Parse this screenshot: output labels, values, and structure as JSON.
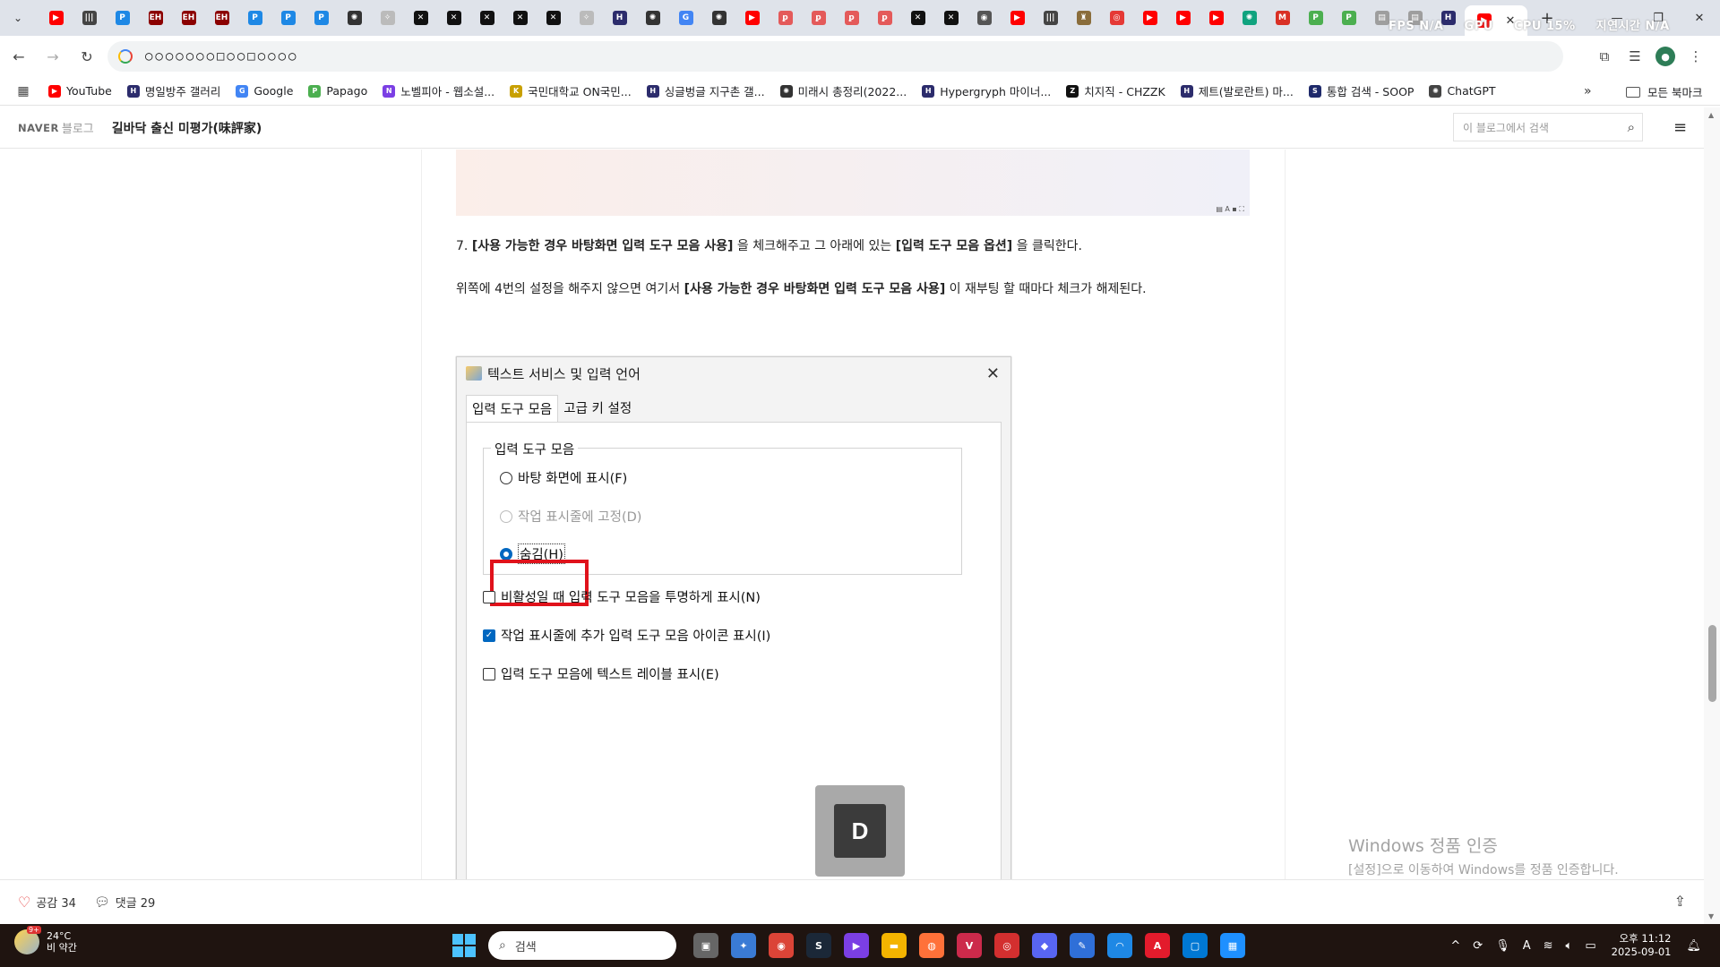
{
  "browser": {
    "tabs": [
      {
        "icon": "youtube-icon",
        "color": "#ff0000",
        "glyph": "▶"
      },
      {
        "icon": "bars-icon",
        "color": "#444444",
        "glyph": "|||"
      },
      {
        "icon": "p-icon",
        "color": "#1e88e5",
        "glyph": "P"
      },
      {
        "icon": "eh-icon",
        "color": "#8b0000",
        "glyph": "EH"
      },
      {
        "icon": "eh-icon",
        "color": "#8b0000",
        "glyph": "EH"
      },
      {
        "icon": "eh-icon",
        "color": "#8b0000",
        "glyph": "EH"
      },
      {
        "icon": "p-icon",
        "color": "#1e88e5",
        "glyph": "P"
      },
      {
        "icon": "p-icon",
        "color": "#1e88e5",
        "glyph": "P"
      },
      {
        "icon": "p-icon",
        "color": "#1e88e5",
        "glyph": "P"
      },
      {
        "icon": "openai-icon",
        "color": "#333333",
        "glyph": "✺"
      },
      {
        "icon": "feather-icon",
        "color": "#bbbbbb",
        "glyph": "✧"
      },
      {
        "icon": "x-icon",
        "color": "#111111",
        "glyph": "✕"
      },
      {
        "icon": "x-icon",
        "color": "#111111",
        "glyph": "✕"
      },
      {
        "icon": "x-icon",
        "color": "#111111",
        "glyph": "✕"
      },
      {
        "icon": "x-icon",
        "color": "#111111",
        "glyph": "✕"
      },
      {
        "icon": "x-icon",
        "color": "#111111",
        "glyph": "✕"
      },
      {
        "icon": "feather-icon",
        "color": "#bbbbbb",
        "glyph": "✧"
      },
      {
        "icon": "hg-icon",
        "color": "#2c2c6c",
        "glyph": "H"
      },
      {
        "icon": "openai-icon",
        "color": "#333333",
        "glyph": "✺"
      },
      {
        "icon": "google-icon",
        "color": "#4285f4",
        "glyph": "G"
      },
      {
        "icon": "openai-icon",
        "color": "#333333",
        "glyph": "✺"
      },
      {
        "icon": "youtube-icon",
        "color": "#ff0000",
        "glyph": "▶"
      },
      {
        "icon": "pixiv-icon",
        "color": "#e45a5a",
        "glyph": "ꝑ"
      },
      {
        "icon": "pixiv-icon",
        "color": "#e45a5a",
        "glyph": "ꝑ"
      },
      {
        "icon": "pixiv-icon",
        "color": "#e45a5a",
        "glyph": "ꝑ"
      },
      {
        "icon": "pixiv-icon",
        "color": "#e45a5a",
        "glyph": "ꝑ"
      },
      {
        "icon": "x-icon",
        "color": "#111111",
        "glyph": "✕"
      },
      {
        "icon": "x-icon",
        "color": "#111111",
        "glyph": "✕"
      },
      {
        "icon": "globe-icon",
        "color": "#555555",
        "glyph": "◉"
      },
      {
        "icon": "youtube-icon",
        "color": "#ff0000",
        "glyph": "▶"
      },
      {
        "icon": "bars-icon",
        "color": "#444444",
        "glyph": "|||"
      },
      {
        "icon": "game-icon",
        "color": "#8a6d3b",
        "glyph": "♜"
      },
      {
        "icon": "record-icon",
        "color": "#e53935",
        "glyph": "◎"
      },
      {
        "icon": "youtube-icon",
        "color": "#ff0000",
        "glyph": "▶"
      },
      {
        "icon": "youtube-icon",
        "color": "#ff0000",
        "glyph": "▶"
      },
      {
        "icon": "youtube-icon",
        "color": "#ff0000",
        "glyph": "▶"
      },
      {
        "icon": "chatgpt-icon",
        "color": "#10a37f",
        "glyph": "✺"
      },
      {
        "icon": "gmail-icon",
        "color": "#d93025",
        "glyph": "M"
      },
      {
        "icon": "papago-icon",
        "color": "#4caf50",
        "glyph": "P"
      },
      {
        "icon": "papago-icon",
        "color": "#4caf50",
        "glyph": "P"
      },
      {
        "icon": "doc-icon",
        "color": "#9e9e9e",
        "glyph": "▤"
      },
      {
        "icon": "doc-icon",
        "color": "#9e9e9e",
        "glyph": "▤"
      },
      {
        "icon": "hg-icon",
        "color": "#2c2c6c",
        "glyph": "H"
      },
      {
        "icon": "youtube-icon",
        "color": "#ff0000",
        "glyph": "▶"
      }
    ],
    "active_tab_close": "✕",
    "new_tab": "+",
    "overlay": [
      "FPS N/A",
      "GPU",
      "CPU 15%",
      "지연시간 N/A"
    ],
    "url": "○○○○○○○□○○□○○○○",
    "bookmarks": [
      {
        "label": "YouTube",
        "color": "#ff0000",
        "glyph": "▶"
      },
      {
        "label": "명일방주 갤러리",
        "color": "#2c2c6c",
        "glyph": "H"
      },
      {
        "label": "Google",
        "color": "#4285f4",
        "glyph": "G"
      },
      {
        "label": "Papago",
        "color": "#4caf50",
        "glyph": "P"
      },
      {
        "label": "노벨피아 - 웹소설...",
        "color": "#7b3fe4",
        "glyph": "N"
      },
      {
        "label": "국민대학교 ON국민...",
        "color": "#c8a000",
        "glyph": "K"
      },
      {
        "label": "싱글벙글 지구촌 갤...",
        "color": "#2c2c6c",
        "glyph": "H"
      },
      {
        "label": "미래시 총정리(2022...",
        "color": "#333333",
        "glyph": "✺"
      },
      {
        "label": "Hypergryph 마이너...",
        "color": "#2c2c6c",
        "glyph": "H"
      },
      {
        "label": "치지직 - CHZZK",
        "color": "#111111",
        "glyph": "Z"
      },
      {
        "label": "제트(발로란트) 마...",
        "color": "#2c2c6c",
        "glyph": "H"
      },
      {
        "label": "통합 검색 - SOOP",
        "color": "#1f2a6b",
        "glyph": "S"
      },
      {
        "label": "ChatGPT",
        "color": "#444444",
        "glyph": "✺"
      }
    ],
    "bookmarks_more": "»",
    "all_bookmarks": "모든 북마크"
  },
  "blog": {
    "naver": "NAVER",
    "blog_word": "블로그",
    "title": "길바닥 출신 미평가(味評家)",
    "search_placeholder": "이 블로그에서 검색",
    "prev_image_mark": "▤ A ▪ ⛶",
    "step7": {
      "prefix": "7. ",
      "bold1": "[사용 가능한 경우 바탕화면 입력 도구 모음 사용]",
      "mid": " 을 체크해주고 그 아래에 있는 ",
      "bold2": "[입력 도구 모음 옵션]",
      "suffix": " 을 클릭한다."
    },
    "note": {
      "prefix": "위쪽에 4번의 설정을 해주지 않으면 여기서 ",
      "bold": "[사용 가능한 경우 바탕화면 입력 도구 모음 사용]",
      "suffix": " 이 재부팅 할 때마다 체크가 해제된다."
    },
    "likes_label": "공감 34",
    "comments_label": "댓글 29"
  },
  "dialog": {
    "title": "텍스트 서비스 및 입력 언어",
    "close": "✕",
    "tabs": [
      "입력 도구 모음",
      "고급 키 설정"
    ],
    "group_label": "입력 도구 모음",
    "radio_desktop": "바탕 화면에 표시(F)",
    "radio_taskbar": "작업 표시줄에 고정(D)",
    "radio_hidden": "숨김(H)",
    "chk_transparent": "비활성일 때 입력 도구 모음을 투명하게 표시(N)",
    "chk_extra_icons": "작업 표시줄에 추가 입력 도구 모음 아이콘 표시(I)",
    "chk_text_labels": "입력 도구 모음에 텍스트 레이블 표시(E)",
    "key_overlay": "D"
  },
  "activation": {
    "line1": "Windows 정품 인증",
    "line2": "[설정]으로 이동하여 Windows를 정품 인증합니다."
  },
  "taskbar": {
    "weather_temp": "24°C",
    "weather_desc": "비 약간",
    "weather_badge": "9+",
    "search_label": "검색",
    "apps": [
      {
        "name": "taskview-icon",
        "color": "#666666",
        "glyph": "▣"
      },
      {
        "name": "copilot-icon",
        "color": "#3a7bd5",
        "glyph": "✦"
      },
      {
        "name": "chrome-icon",
        "color": "#db4437",
        "glyph": "◉"
      },
      {
        "name": "steam-icon",
        "color": "#1b2838",
        "glyph": "S"
      },
      {
        "name": "vs-icon",
        "color": "#7b3fe4",
        "glyph": "▶"
      },
      {
        "name": "explorer-icon",
        "color": "#f4b400",
        "glyph": "▬"
      },
      {
        "name": "firefox-icon",
        "color": "#ff7139",
        "glyph": "◍"
      },
      {
        "name": "vscode-icon",
        "color": "#cc2a4b",
        "glyph": "V"
      },
      {
        "name": "obs-icon",
        "color": "#d32f2f",
        "glyph": "◎"
      },
      {
        "name": "discord-icon",
        "color": "#5865f2",
        "glyph": "◆"
      },
      {
        "name": "paint-icon",
        "color": "#2f6fd8",
        "glyph": "✎"
      },
      {
        "name": "arc-icon",
        "color": "#1e88e5",
        "glyph": "◠"
      },
      {
        "name": "autocad-icon",
        "color": "#e31b2c",
        "glyph": "A"
      },
      {
        "name": "window-icon",
        "color": "#0078d4",
        "glyph": "▢"
      },
      {
        "name": "photos-icon",
        "color": "#1e90ff",
        "glyph": "▦"
      }
    ],
    "tray_chevron": "^",
    "ime": "A",
    "time": "오후 11:12",
    "date": "2025-09-01"
  }
}
